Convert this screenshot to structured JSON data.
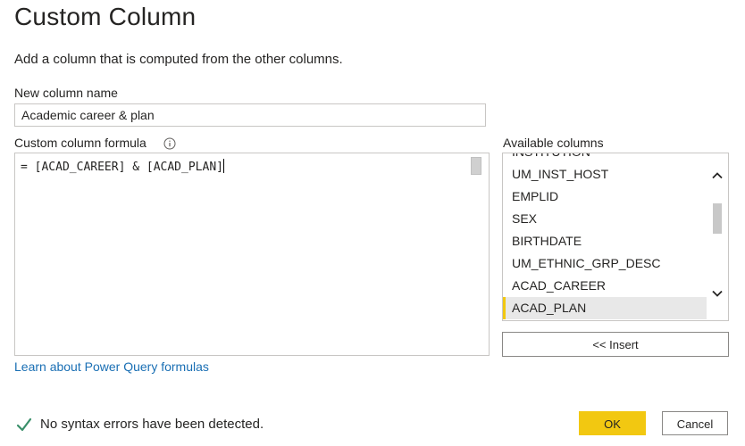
{
  "dialog": {
    "title": "Custom Column",
    "description": "Add a column that is computed from the other columns."
  },
  "new_column": {
    "label": "New column name",
    "value": "Academic career & plan"
  },
  "formula": {
    "label": "Custom column formula",
    "info_icon": "info-circle-icon",
    "value": "= [ACAD_CAREER] & [ACAD_PLAN]"
  },
  "available_columns": {
    "label": "Available columns",
    "items": [
      "INSTITUTION",
      "UM_INST_HOST",
      "EMPLID",
      "SEX",
      "BIRTHDATE",
      "UM_ETHNIC_GRP_DESC",
      "ACAD_CAREER",
      "ACAD_PLAN"
    ],
    "selected": "ACAD_PLAN",
    "insert_label": "<< Insert"
  },
  "learn_link": "Learn about Power Query formulas",
  "status": {
    "icon": "checkmark-icon",
    "text": "No syntax errors have been detected."
  },
  "buttons": {
    "ok": "OK",
    "cancel": "Cancel"
  },
  "colors": {
    "accent": "#f2c811",
    "link": "#1a6fb4",
    "success": "#2e8b57"
  }
}
